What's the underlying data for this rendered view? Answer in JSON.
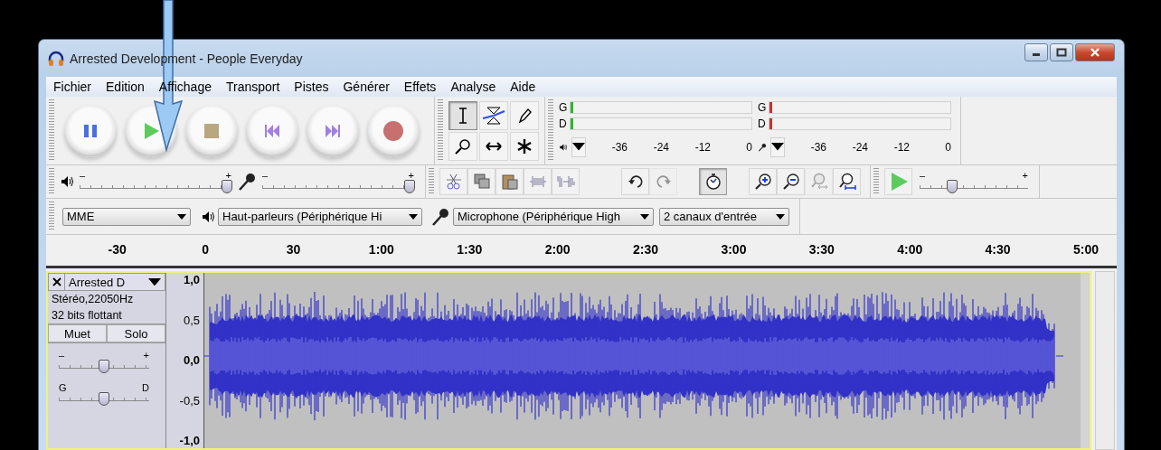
{
  "window": {
    "title": "Arrested Development - People Everyday"
  },
  "menu": [
    "Fichier",
    "Edition",
    "Affichage",
    "Transport",
    "Pistes",
    "Générer",
    "Effets",
    "Analyse",
    "Aide"
  ],
  "transport": [
    {
      "kind": "pause"
    },
    {
      "kind": "play"
    },
    {
      "kind": "stop"
    },
    {
      "kind": "skip-start"
    },
    {
      "kind": "skip-end"
    },
    {
      "kind": "record"
    }
  ],
  "tools": [
    {
      "kind": "selection",
      "selected": true
    },
    {
      "kind": "envelope",
      "selected": false
    },
    {
      "kind": "draw",
      "selected": false
    },
    {
      "kind": "zoom",
      "selected": false
    },
    {
      "kind": "timeshift",
      "selected": false
    },
    {
      "kind": "multi",
      "selected": false
    }
  ],
  "meters": [
    {
      "kind": "playback",
      "color": "#2fb52f",
      "channels": [
        "G",
        "D"
      ],
      "ticks": [
        "-36",
        "-24",
        "-12",
        "0"
      ]
    },
    {
      "kind": "recording",
      "color": "#c83232",
      "channels": [
        "G",
        "D"
      ],
      "ticks": [
        "-36",
        "-24",
        "-12",
        "0"
      ]
    }
  ],
  "mixer": [
    {
      "kind": "output",
      "min_label": "–",
      "max_label": "+",
      "level": 0.97
    },
    {
      "kind": "input",
      "min_label": "–",
      "max_label": "+",
      "level": 0.97
    }
  ],
  "edit_tools": [
    {
      "kind": "cut",
      "disabled": false,
      "pressed": false
    },
    {
      "kind": "copy",
      "disabled": false,
      "pressed": false
    },
    {
      "kind": "paste",
      "disabled": false,
      "pressed": false
    },
    {
      "kind": "trim",
      "disabled": false,
      "pressed": false
    },
    {
      "kind": "silence",
      "disabled": false,
      "pressed": false
    },
    {
      "kind": "undo",
      "disabled": false,
      "pressed": false
    },
    {
      "kind": "redo",
      "disabled": true,
      "pressed": false
    },
    {
      "kind": "sync",
      "disabled": false,
      "pressed": true
    },
    {
      "kind": "zoom-in",
      "disabled": false,
      "pressed": false
    },
    {
      "kind": "zoom-out",
      "disabled": false,
      "pressed": false
    },
    {
      "kind": "fit-selection",
      "disabled": true,
      "pressed": false
    },
    {
      "kind": "fit-project",
      "disabled": false,
      "pressed": false
    }
  ],
  "play_at_speed": {
    "min_label": "–",
    "max_label": "+",
    "level": 0.3
  },
  "devices": {
    "host": "MME",
    "output": "Haut-parleurs (Périphérique Hi",
    "input": "Microphone (Périphérique High",
    "channels": "2 canaux d'entrée"
  },
  "ruler": [
    "-30",
    "0",
    "30",
    "1:00",
    "1:30",
    "2:00",
    "2:30",
    "3:00",
    "3:30",
    "4:00",
    "4:30",
    "5:00"
  ],
  "track": {
    "name": "Arrested D",
    "format": "Stéréo,22050Hz",
    "sample": "32 bits flottant",
    "buttons": [
      {
        "label": "Muet",
        "selected": false
      },
      {
        "label": "Solo",
        "selected": false
      }
    ],
    "gain": {
      "min_label": "–",
      "max_label": "+",
      "level": 0.5
    },
    "pan": {
      "min_label": "G",
      "max_label": "D",
      "level": 0.5
    },
    "axis": [
      "1,0",
      "0,5",
      "0,0",
      "-0,5",
      "-1,0"
    ]
  }
}
